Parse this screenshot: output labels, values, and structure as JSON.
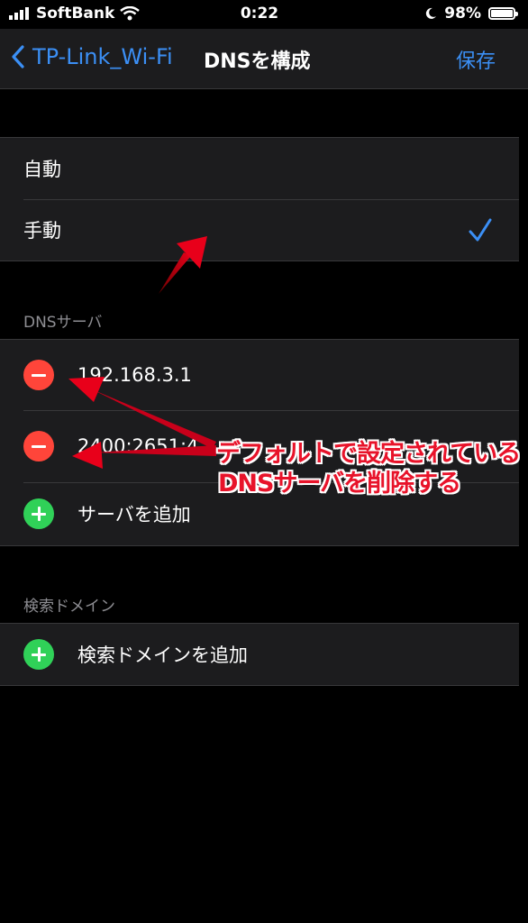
{
  "status_bar": {
    "carrier": "SoftBank",
    "time": "0:22",
    "battery": "98%",
    "battery_level": 0.98
  },
  "nav": {
    "back_label": "TP-Link_Wi-Fi",
    "title": "DNSを構成",
    "save_label": "保存"
  },
  "mode": {
    "options": [
      {
        "label": "自動",
        "selected": false
      },
      {
        "label": "手動",
        "selected": true
      }
    ]
  },
  "dns_section": {
    "header": "DNSサーバ",
    "servers": [
      "192.168.3.1",
      "2400:2651:4"
    ],
    "add_label": "サーバを追加"
  },
  "search_section": {
    "header": "検索ドメイン",
    "add_label": "検索ドメインを追加"
  },
  "annotation": {
    "line1": "デフォルトで設定されている",
    "line2": "DNSサーバを削除する",
    "color": "#e8132a"
  },
  "colors": {
    "accent": "#3b8ff5",
    "delete": "#ff453a",
    "add": "#30d158"
  }
}
